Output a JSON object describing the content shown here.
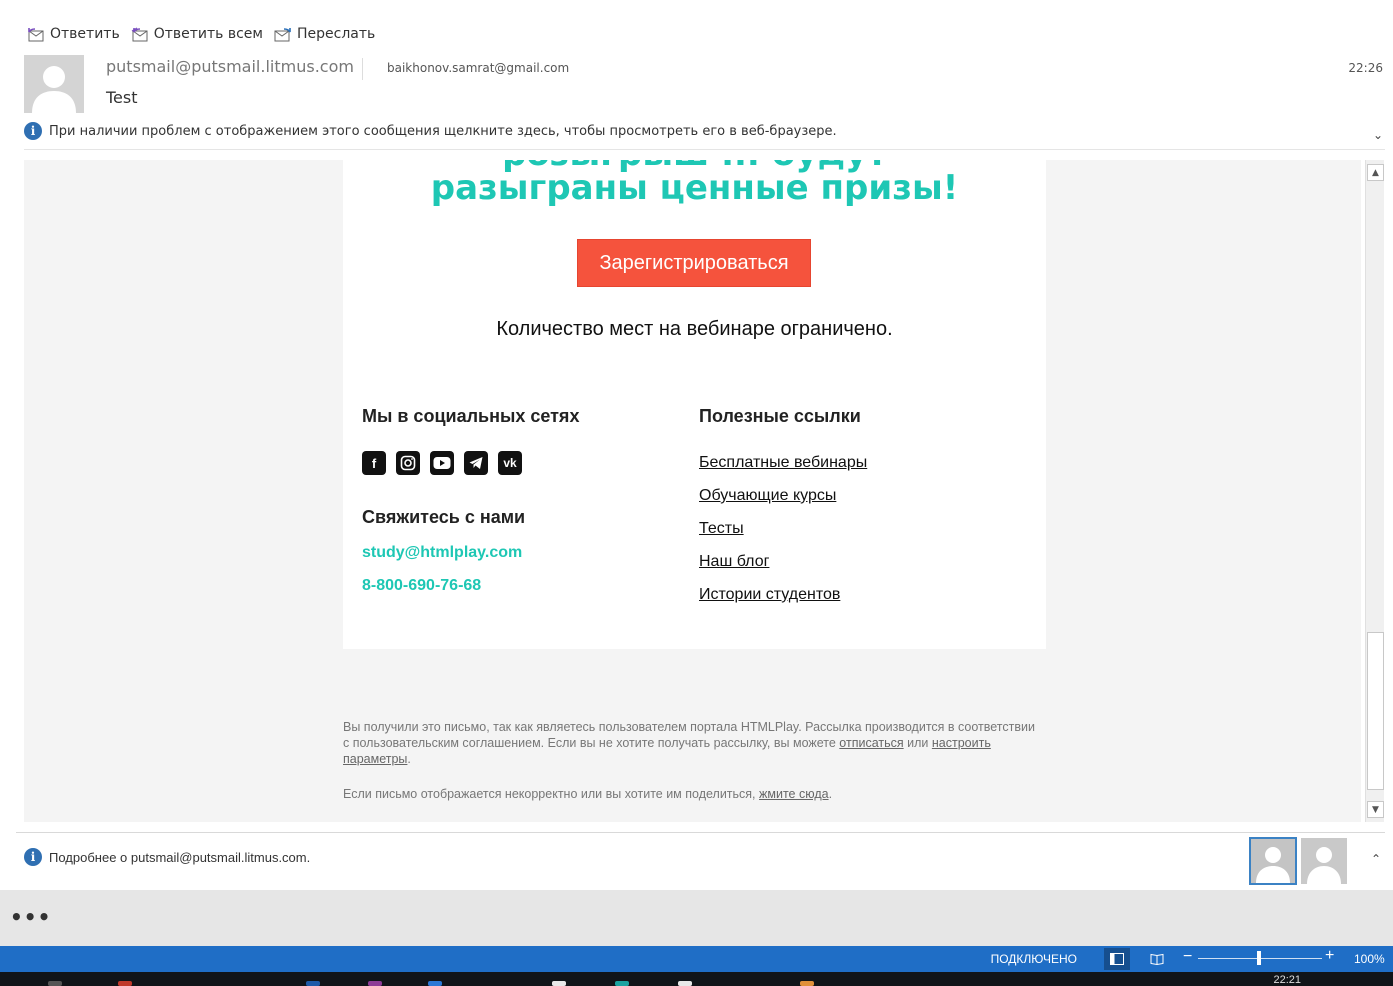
{
  "toolbar": {
    "reply": "Ответить",
    "reply_all": "Ответить всем",
    "forward": "Переслать"
  },
  "header": {
    "sender": "putsmail@putsmail.litmus.com",
    "recipient": "baikhonov.samrat@gmail.com",
    "time": "22:26",
    "subject": "Test",
    "info_message": "При наличии проблем с отображением этого сообщения щелкните здесь, чтобы просмотреть его в веб-браузере."
  },
  "email": {
    "headline_cut": "розыгрыш ... будут",
    "headline": "разыграны ценные призы!",
    "cta_label": "Зарегистрироваться",
    "limited_seats": "Количество мест на вебинаре ограничено.",
    "social_heading": "Мы в социальных сетях",
    "social_icons": [
      "facebook-icon",
      "instagram-icon",
      "youtube-icon",
      "telegram-icon",
      "vk-icon"
    ],
    "contact_heading": "Свяжитесь с нами",
    "contact_email": "study@htmlplay.com",
    "contact_phone": "8-800-690-76-68",
    "links_heading": "Полезные ссылки",
    "links": [
      "Бесплатные вебинары",
      "Обучающие курсы",
      "Тесты",
      "Наш блог",
      "Истории студентов"
    ],
    "footer_p1": "Вы получили это письмо, так как являетесь пользователем портала HTMLPlay. Рассылка производится в соответствии с пользовательским соглашением. Если вы не хотите получать рассылку, вы можете",
    "unsubscribe": "отписаться",
    "or": "или",
    "settings": "настроить параметры",
    "footer_p2": "Если письмо отображается некорректно или вы хотите им поделиться,",
    "click_here": "жмите сюда",
    "colors": {
      "accent": "#1ec7b4",
      "cta": "#f5533d",
      "background": "#f4f4f4"
    }
  },
  "people_pane": {
    "label": "Подробнее о putsmail@putsmail.litmus.com."
  },
  "more_label": "•••",
  "status_bar": {
    "status": "ПОДКЛЮЧЕНО",
    "zoom": "100%",
    "color": "#1f6ec6"
  },
  "taskbar": {
    "clock": "22:21"
  }
}
